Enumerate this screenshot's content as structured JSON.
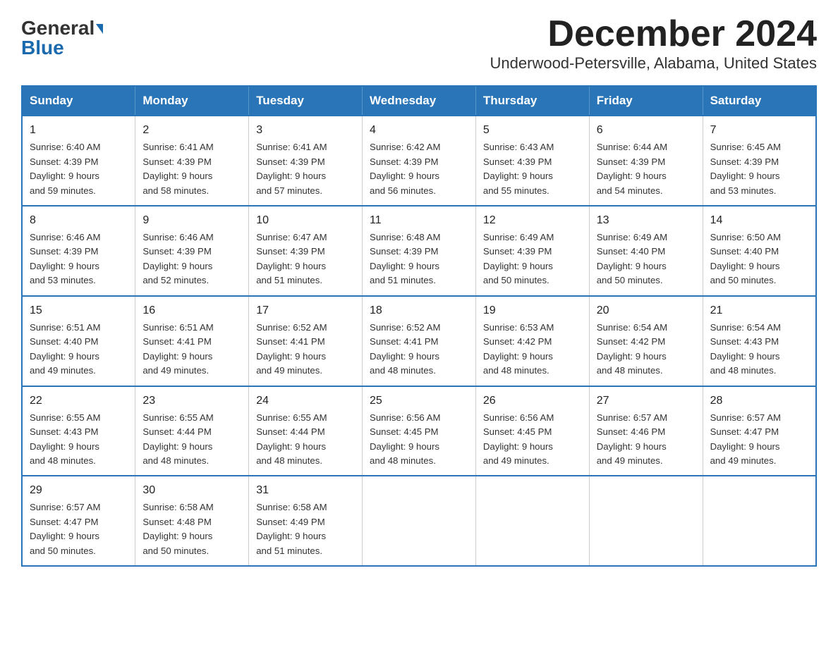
{
  "logo": {
    "general": "General",
    "blue": "Blue"
  },
  "title": "December 2024",
  "subtitle": "Underwood-Petersville, Alabama, United States",
  "days_of_week": [
    "Sunday",
    "Monday",
    "Tuesday",
    "Wednesday",
    "Thursday",
    "Friday",
    "Saturday"
  ],
  "weeks": [
    [
      {
        "day": "1",
        "sunrise": "6:40 AM",
        "sunset": "4:39 PM",
        "daylight": "9 hours and 59 minutes."
      },
      {
        "day": "2",
        "sunrise": "6:41 AM",
        "sunset": "4:39 PM",
        "daylight": "9 hours and 58 minutes."
      },
      {
        "day": "3",
        "sunrise": "6:41 AM",
        "sunset": "4:39 PM",
        "daylight": "9 hours and 57 minutes."
      },
      {
        "day": "4",
        "sunrise": "6:42 AM",
        "sunset": "4:39 PM",
        "daylight": "9 hours and 56 minutes."
      },
      {
        "day": "5",
        "sunrise": "6:43 AM",
        "sunset": "4:39 PM",
        "daylight": "9 hours and 55 minutes."
      },
      {
        "day": "6",
        "sunrise": "6:44 AM",
        "sunset": "4:39 PM",
        "daylight": "9 hours and 54 minutes."
      },
      {
        "day": "7",
        "sunrise": "6:45 AM",
        "sunset": "4:39 PM",
        "daylight": "9 hours and 53 minutes."
      }
    ],
    [
      {
        "day": "8",
        "sunrise": "6:46 AM",
        "sunset": "4:39 PM",
        "daylight": "9 hours and 53 minutes."
      },
      {
        "day": "9",
        "sunrise": "6:46 AM",
        "sunset": "4:39 PM",
        "daylight": "9 hours and 52 minutes."
      },
      {
        "day": "10",
        "sunrise": "6:47 AM",
        "sunset": "4:39 PM",
        "daylight": "9 hours and 51 minutes."
      },
      {
        "day": "11",
        "sunrise": "6:48 AM",
        "sunset": "4:39 PM",
        "daylight": "9 hours and 51 minutes."
      },
      {
        "day": "12",
        "sunrise": "6:49 AM",
        "sunset": "4:39 PM",
        "daylight": "9 hours and 50 minutes."
      },
      {
        "day": "13",
        "sunrise": "6:49 AM",
        "sunset": "4:40 PM",
        "daylight": "9 hours and 50 minutes."
      },
      {
        "day": "14",
        "sunrise": "6:50 AM",
        "sunset": "4:40 PM",
        "daylight": "9 hours and 50 minutes."
      }
    ],
    [
      {
        "day": "15",
        "sunrise": "6:51 AM",
        "sunset": "4:40 PM",
        "daylight": "9 hours and 49 minutes."
      },
      {
        "day": "16",
        "sunrise": "6:51 AM",
        "sunset": "4:41 PM",
        "daylight": "9 hours and 49 minutes."
      },
      {
        "day": "17",
        "sunrise": "6:52 AM",
        "sunset": "4:41 PM",
        "daylight": "9 hours and 49 minutes."
      },
      {
        "day": "18",
        "sunrise": "6:52 AM",
        "sunset": "4:41 PM",
        "daylight": "9 hours and 48 minutes."
      },
      {
        "day": "19",
        "sunrise": "6:53 AM",
        "sunset": "4:42 PM",
        "daylight": "9 hours and 48 minutes."
      },
      {
        "day": "20",
        "sunrise": "6:54 AM",
        "sunset": "4:42 PM",
        "daylight": "9 hours and 48 minutes."
      },
      {
        "day": "21",
        "sunrise": "6:54 AM",
        "sunset": "4:43 PM",
        "daylight": "9 hours and 48 minutes."
      }
    ],
    [
      {
        "day": "22",
        "sunrise": "6:55 AM",
        "sunset": "4:43 PM",
        "daylight": "9 hours and 48 minutes."
      },
      {
        "day": "23",
        "sunrise": "6:55 AM",
        "sunset": "4:44 PM",
        "daylight": "9 hours and 48 minutes."
      },
      {
        "day": "24",
        "sunrise": "6:55 AM",
        "sunset": "4:44 PM",
        "daylight": "9 hours and 48 minutes."
      },
      {
        "day": "25",
        "sunrise": "6:56 AM",
        "sunset": "4:45 PM",
        "daylight": "9 hours and 48 minutes."
      },
      {
        "day": "26",
        "sunrise": "6:56 AM",
        "sunset": "4:45 PM",
        "daylight": "9 hours and 49 minutes."
      },
      {
        "day": "27",
        "sunrise": "6:57 AM",
        "sunset": "4:46 PM",
        "daylight": "9 hours and 49 minutes."
      },
      {
        "day": "28",
        "sunrise": "6:57 AM",
        "sunset": "4:47 PM",
        "daylight": "9 hours and 49 minutes."
      }
    ],
    [
      {
        "day": "29",
        "sunrise": "6:57 AM",
        "sunset": "4:47 PM",
        "daylight": "9 hours and 50 minutes."
      },
      {
        "day": "30",
        "sunrise": "6:58 AM",
        "sunset": "4:48 PM",
        "daylight": "9 hours and 50 minutes."
      },
      {
        "day": "31",
        "sunrise": "6:58 AM",
        "sunset": "4:49 PM",
        "daylight": "9 hours and 51 minutes."
      },
      null,
      null,
      null,
      null
    ]
  ],
  "labels": {
    "sunrise": "Sunrise:",
    "sunset": "Sunset:",
    "daylight": "Daylight:"
  }
}
